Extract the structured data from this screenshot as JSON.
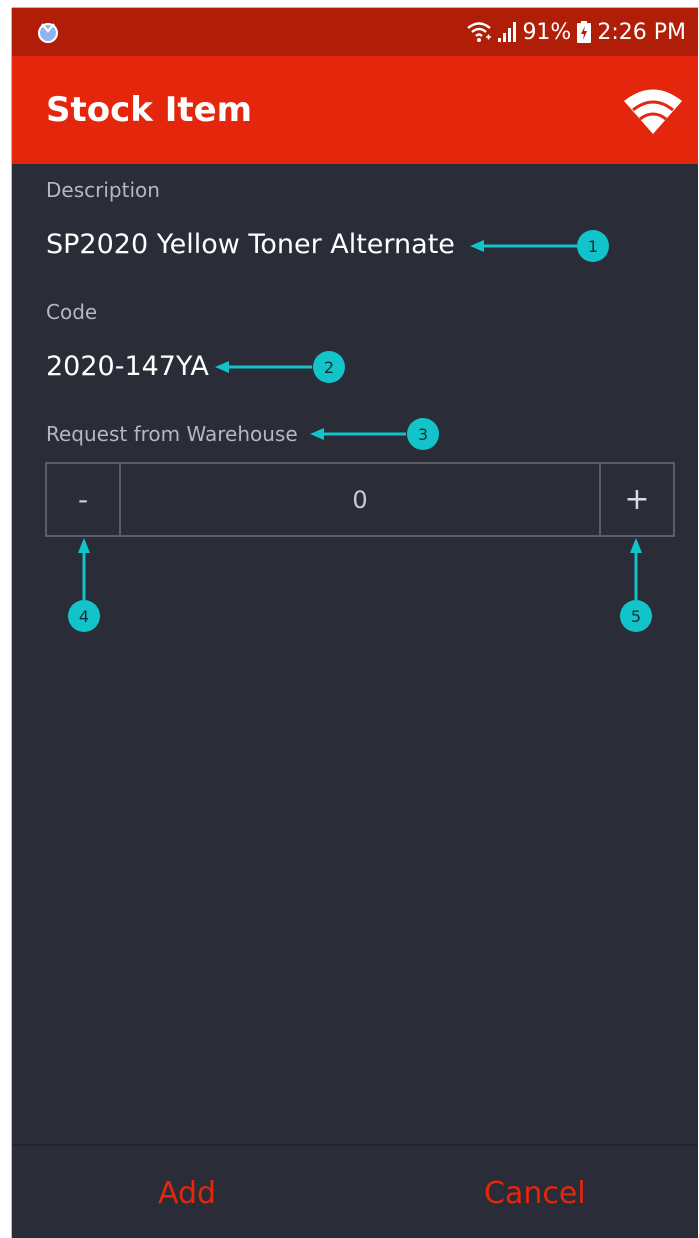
{
  "status_bar": {
    "battery": "91%",
    "time": "2:26 PM",
    "icons": [
      "notification-app-icon",
      "wifi-signal-icon",
      "cell-signal-icon",
      "battery-charging-icon"
    ]
  },
  "app_bar": {
    "title": "Stock Item",
    "action_icon": "wifi-icon"
  },
  "form": {
    "description_label": "Description",
    "description_value": "SP2020 Yellow Toner Alternate",
    "code_label": "Code",
    "code_value": "2020-147YA",
    "request_label": "Request from Warehouse",
    "quantity": {
      "decrement_label": "-",
      "value": "0",
      "increment_label": "+"
    }
  },
  "annotations": [
    "1",
    "2",
    "3",
    "4",
    "5"
  ],
  "footer": {
    "add_label": "Add",
    "cancel_label": "Cancel"
  },
  "colors": {
    "status_bar": "#b11e07",
    "app_bar": "#e3260c",
    "background": "#2a2d37",
    "accent_text": "#e3260c",
    "annotation": "#12c3c9"
  }
}
